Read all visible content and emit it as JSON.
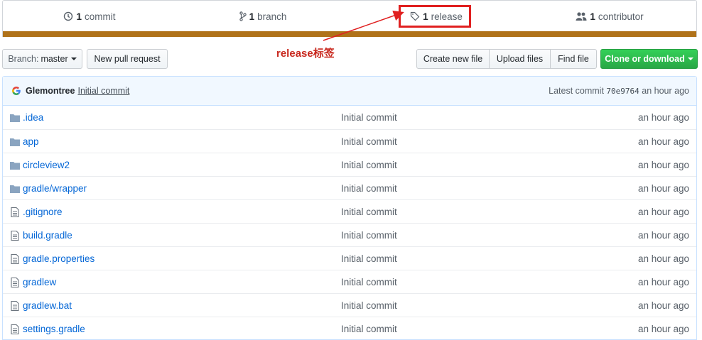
{
  "summary": {
    "commits": {
      "count": "1",
      "label": "commit",
      "icon": "history-icon"
    },
    "branches": {
      "count": "1",
      "label": "branch",
      "icon": "branch-icon"
    },
    "releases": {
      "count": "1",
      "label": "release",
      "icon": "tag-icon"
    },
    "contributors": {
      "count": "1",
      "label": "contributor",
      "icon": "people-icon"
    },
    "language_color": "#b07219"
  },
  "annotation": {
    "text": "release标签",
    "color": "#e02020"
  },
  "toolbar": {
    "branch_prefix": "Branch:",
    "branch_name": "master",
    "new_pull_request": "New pull request",
    "create_new_file": "Create new file",
    "upload_files": "Upload files",
    "find_file": "Find file",
    "clone_or_download": "Clone or download",
    "clone_color": "#28a745"
  },
  "latest_commit": {
    "author": "Glemontree",
    "message": "Initial commit",
    "prefix": "Latest commit",
    "sha": "70e9764",
    "age": "an hour ago"
  },
  "files": [
    {
      "name": ".idea",
      "type": "folder",
      "message": "Initial commit",
      "age": "an hour ago"
    },
    {
      "name": "app",
      "type": "folder",
      "message": "Initial commit",
      "age": "an hour ago"
    },
    {
      "name": "circleview2",
      "type": "folder",
      "message": "Initial commit",
      "age": "an hour ago"
    },
    {
      "name": "gradle/wrapper",
      "type": "folder",
      "message": "Initial commit",
      "age": "an hour ago"
    },
    {
      "name": ".gitignore",
      "type": "file",
      "message": "Initial commit",
      "age": "an hour ago"
    },
    {
      "name": "build.gradle",
      "type": "file",
      "message": "Initial commit",
      "age": "an hour ago"
    },
    {
      "name": "gradle.properties",
      "type": "file",
      "message": "Initial commit",
      "age": "an hour ago"
    },
    {
      "name": "gradlew",
      "type": "file",
      "message": "Initial commit",
      "age": "an hour ago"
    },
    {
      "name": "gradlew.bat",
      "type": "file",
      "message": "Initial commit",
      "age": "an hour ago"
    },
    {
      "name": "settings.gradle",
      "type": "file",
      "message": "Initial commit",
      "age": "an hour ago"
    }
  ]
}
